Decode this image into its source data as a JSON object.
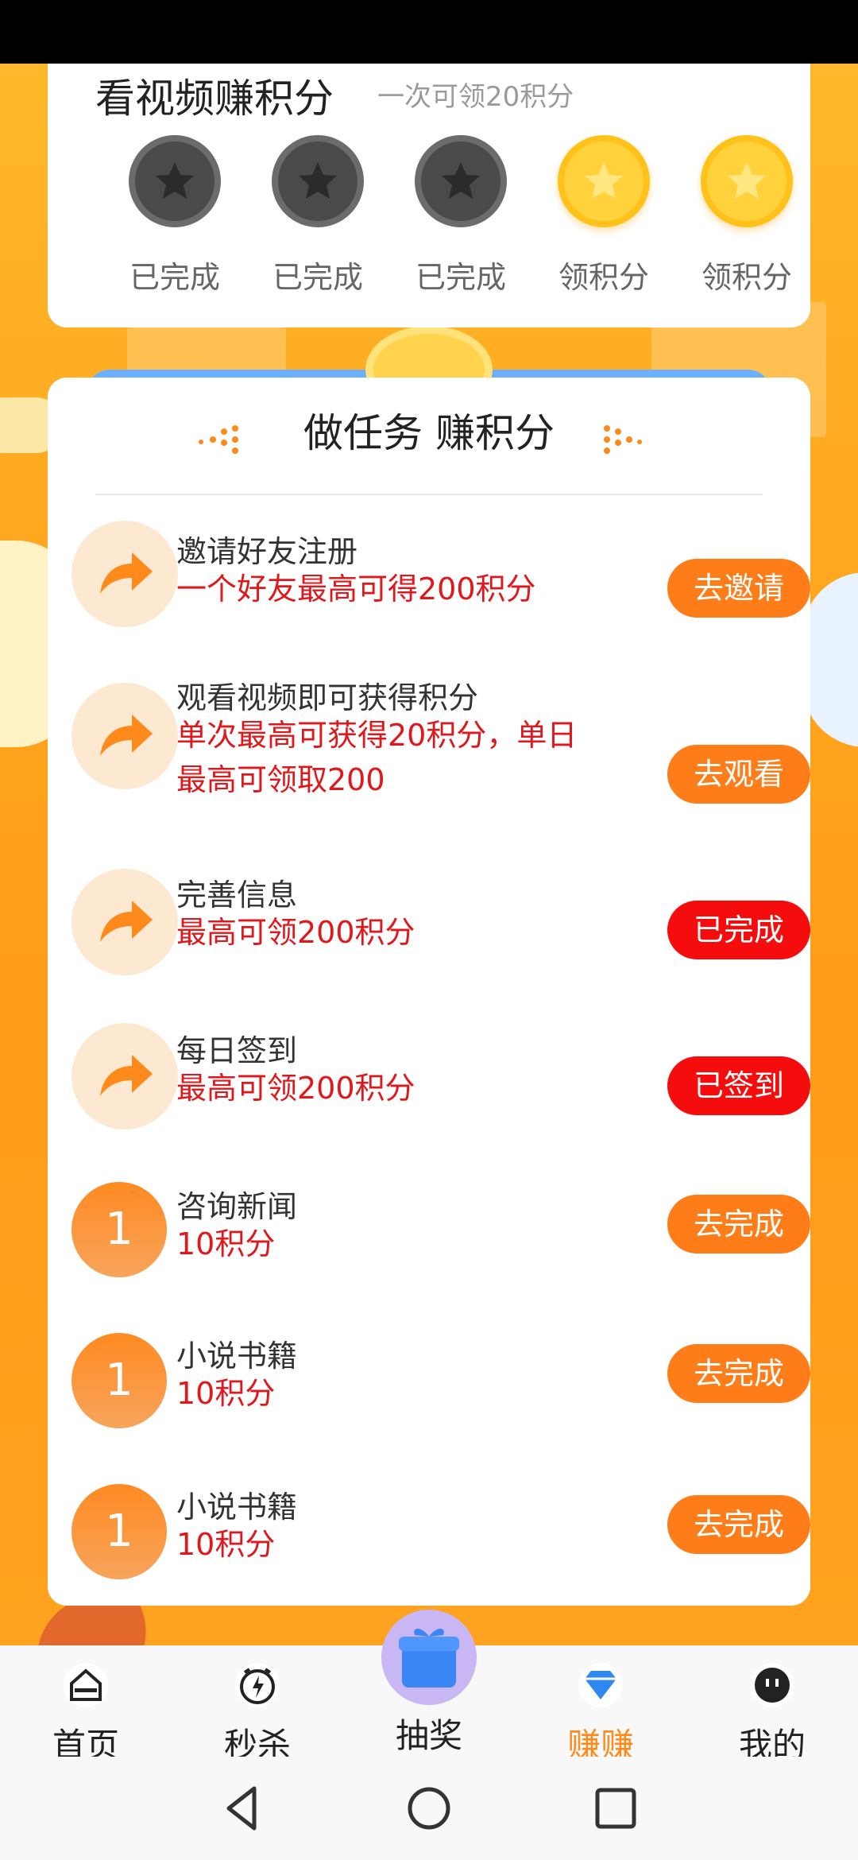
{
  "video_card": {
    "title": "看视频赚积分",
    "subtitle": "一次可领20积分",
    "coins": [
      {
        "state": "done",
        "label": "已完成"
      },
      {
        "state": "done",
        "label": "已完成"
      },
      {
        "state": "done",
        "label": "已完成"
      },
      {
        "state": "available",
        "label": "领积分"
      },
      {
        "state": "available",
        "label": "领积分"
      }
    ]
  },
  "tasks": {
    "title": "做任务 赚积分",
    "items": [
      {
        "icon": "share-arrow-icon",
        "name": "邀请好友注册",
        "desc": "一个好友最高可得200积分",
        "button": "去邀请",
        "button_style": "orange"
      },
      {
        "icon": "share-arrow-icon",
        "name": "观看视频即可获得积分",
        "desc": "单次最高可获得20积分，单日最高可领取200",
        "button": "去观看",
        "button_style": "orange"
      },
      {
        "icon": "share-arrow-icon",
        "name": "完善信息",
        "desc": "最高可领200积分",
        "button": "已完成",
        "button_style": "red"
      },
      {
        "icon": "share-arrow-icon",
        "name": "每日签到",
        "desc": "最高可领200积分",
        "button": "已签到",
        "button_style": "red"
      },
      {
        "icon_number": "1",
        "name": "咨询新闻",
        "desc": "10积分",
        "button": "去完成",
        "button_style": "orange"
      },
      {
        "icon_number": "1",
        "name": "小说书籍",
        "desc": "10积分",
        "button": "去完成",
        "button_style": "orange"
      },
      {
        "icon_number": "1",
        "name": "小说书籍",
        "desc": "10积分",
        "button": "去完成",
        "button_style": "orange"
      }
    ]
  },
  "bottom_nav": {
    "items": [
      {
        "label": "首页",
        "icon": "home-icon"
      },
      {
        "label": "秒杀",
        "icon": "flash-clock-icon"
      },
      {
        "label": "抽奖",
        "icon": "gift-icon"
      },
      {
        "label": "赚赚",
        "icon": "diamond-icon",
        "active": true
      },
      {
        "label": "我的",
        "icon": "profile-face-icon"
      }
    ]
  },
  "colors": {
    "accent": "#ff7d18",
    "done_red": "#f50c0c",
    "desc_red": "#e0181c",
    "active_nav": "#ff8a1c",
    "background": "#ffa21a"
  }
}
